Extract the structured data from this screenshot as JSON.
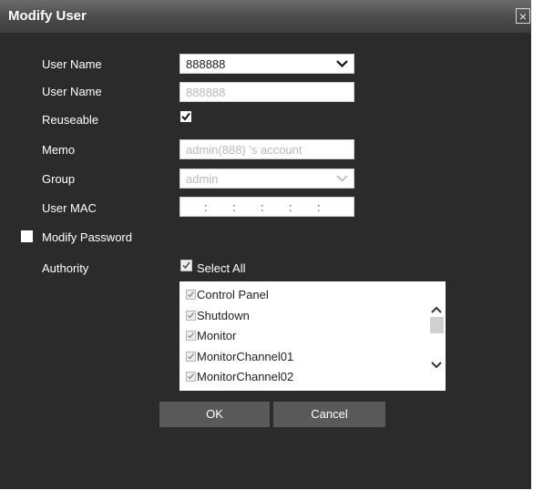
{
  "dialog": {
    "title": "Modify User",
    "close_label": "×"
  },
  "form": {
    "user_name_select_label": "User Name",
    "user_name_select_value": "888888",
    "user_name_label": "User Name",
    "user_name_value": "888888",
    "reuseable_label": "Reuseable",
    "reuseable_checked": true,
    "memo_label": "Memo",
    "memo_value": "admin(888) 's account",
    "group_label": "Group",
    "group_value": "admin",
    "user_mac_label": "User MAC",
    "user_mac_separators": [
      ":",
      ":",
      ":",
      ":",
      ":"
    ],
    "modify_password_label": "Modify Password",
    "modify_password_checked": false,
    "authority_label": "Authority",
    "select_all_label": "Select All",
    "select_all_checked": true
  },
  "authority_list": [
    {
      "label": "Control Panel",
      "checked": true
    },
    {
      "label": "Shutdown",
      "checked": true
    },
    {
      "label": "Monitor",
      "checked": true
    },
    {
      "label": "MonitorChannel01",
      "checked": true
    },
    {
      "label": "MonitorChannel02",
      "checked": true
    }
  ],
  "buttons": {
    "ok_label": "OK",
    "cancel_label": "Cancel"
  },
  "colors": {
    "dialog_bg": "#2b2b2b",
    "button_bg": "#595959",
    "field_bg": "#ffffff",
    "disabled_text": "#b9b9b9"
  }
}
